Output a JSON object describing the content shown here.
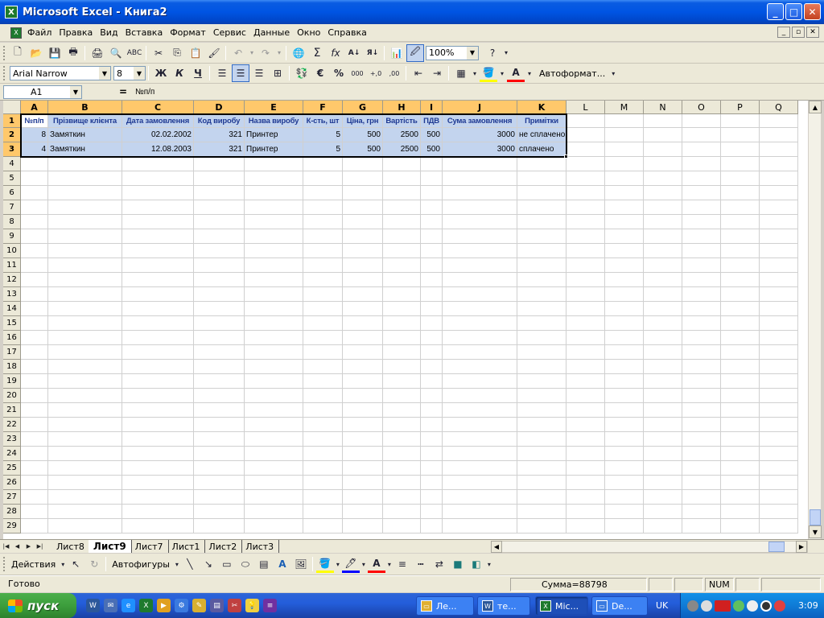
{
  "window": {
    "title": "Microsoft Excel - Книга2",
    "app_icon_glyph": "X",
    "controls": {
      "minimize": "_",
      "maximize": "□",
      "close": "✕"
    }
  },
  "menu": {
    "items": [
      "Файл",
      "Правка",
      "Вид",
      "Вставка",
      "Формат",
      "Сервис",
      "Данные",
      "Окно",
      "Справка"
    ],
    "mdi_controls": [
      "_",
      "▫",
      "✕"
    ]
  },
  "standard_toolbar": {
    "zoom": "100%"
  },
  "formatting_toolbar": {
    "font": "Arial Narrow",
    "size": "8",
    "bold": "Ж",
    "italic": "К",
    "underline": "Ч",
    "autoformat": "Автоформат..."
  },
  "formula_bar": {
    "name_box": "A1",
    "equals": "=",
    "formula": "№п/п"
  },
  "sheet": {
    "columns": [
      "A",
      "B",
      "C",
      "D",
      "E",
      "F",
      "G",
      "H",
      "I",
      "J",
      "K",
      "L",
      "M",
      "N",
      "O",
      "P",
      "Q"
    ],
    "row_count": 29,
    "header_row": [
      "№п/п",
      "Прізвище клієнта",
      "Дата замовлення",
      "Код виробу",
      "Назва виробу",
      "К-сть, шт",
      "Ціна, грн",
      "Вартість",
      "ПДВ",
      "Сума замовлення",
      "Примітки"
    ],
    "data_rows": [
      [
        "8",
        "Замяткин",
        "02.02.2002",
        "321",
        "Принтер",
        "5",
        "500",
        "2500",
        "500",
        "3000",
        "не сплачено"
      ],
      [
        "4",
        "Замяткин",
        "12.08.2003",
        "321",
        "Принтер",
        "5",
        "500",
        "2500",
        "500",
        "3000",
        "сплачено"
      ]
    ]
  },
  "sheet_tabs": {
    "tabs": [
      "Лист8",
      "Лист9",
      "Лист7",
      "Лист1",
      "Лист2",
      "Лист3"
    ],
    "active": "Лист9"
  },
  "drawing_toolbar": {
    "actions": "Действия",
    "autoshapes": "Автофигуры"
  },
  "status_bar": {
    "status": "Готово",
    "sum": "Сумма=88798",
    "num": "NUM"
  },
  "taskbar": {
    "start": "пуск",
    "tasks": [
      "Ле...",
      "те...",
      "Mic...",
      "De..."
    ],
    "lang": "UK",
    "clock": "3:09"
  },
  "colors": {
    "selection": "#c3d4ee",
    "header_text": "#1f3a93",
    "title_bar": "#0054e3",
    "selected_header": "#ffc86b"
  }
}
